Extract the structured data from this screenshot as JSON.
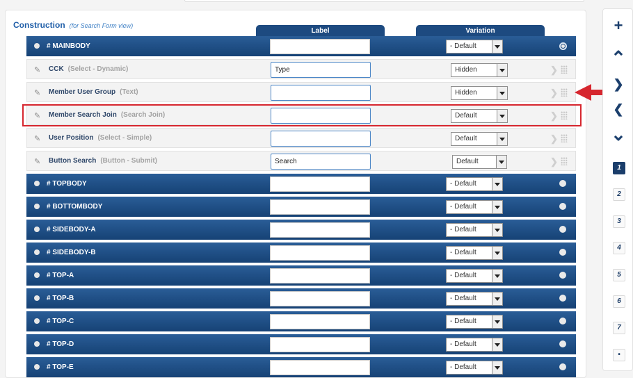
{
  "construction": {
    "title": "Construction",
    "subtitle": "(for Search Form view)"
  },
  "columns": {
    "label": "Label",
    "variation": "Variation"
  },
  "rows": [
    {
      "kind": "position",
      "name": "# MAINBODY",
      "label": "",
      "variation": "- Default",
      "marker": "ring"
    },
    {
      "kind": "field",
      "name": "CCK",
      "type": "(Select - Dynamic)",
      "label": "Type",
      "variation": "Hidden"
    },
    {
      "kind": "field",
      "name": "Member User Group",
      "type": "(Text)",
      "label": "",
      "variation": "Hidden"
    },
    {
      "kind": "field",
      "name": "Member Search Join",
      "type": "(Search Join)",
      "label": "",
      "variation": "Default"
    },
    {
      "kind": "field",
      "name": "User Position",
      "type": "(Select - Simple)",
      "label": "",
      "variation": "Default"
    },
    {
      "kind": "field",
      "name": "Button Search",
      "type": "(Button - Submit)",
      "label": "Search",
      "variation": "Default"
    },
    {
      "kind": "position",
      "name": "# TOPBODY",
      "label": "",
      "variation": "- Default",
      "marker": "radio"
    },
    {
      "kind": "position",
      "name": "# BOTTOMBODY",
      "label": "",
      "variation": "- Default",
      "marker": "radio"
    },
    {
      "kind": "position",
      "name": "# SIDEBODY-A",
      "label": "",
      "variation": "- Default",
      "marker": "radio"
    },
    {
      "kind": "position",
      "name": "# SIDEBODY-B",
      "label": "",
      "variation": "- Default",
      "marker": "radio"
    },
    {
      "kind": "position",
      "name": "# TOP-A",
      "label": "",
      "variation": "- Default",
      "marker": "radio"
    },
    {
      "kind": "position",
      "name": "# TOP-B",
      "label": "",
      "variation": "- Default",
      "marker": "radio"
    },
    {
      "kind": "position",
      "name": "# TOP-C",
      "label": "",
      "variation": "- Default",
      "marker": "radio"
    },
    {
      "kind": "position",
      "name": "# TOP-D",
      "label": "",
      "variation": "- Default",
      "marker": "radio"
    },
    {
      "kind": "position",
      "name": "# TOP-E",
      "label": "",
      "variation": "- Default",
      "marker": "radio"
    }
  ],
  "sidebar": {
    "icons": [
      "plus-icon",
      "chevron-up-icon",
      "chevron-right-icon",
      "chevron-left-icon",
      "chevron-down-icon"
    ],
    "numbers": [
      "1",
      "2",
      "3",
      "4",
      "5",
      "6",
      "7",
      "•"
    ],
    "active": "1"
  },
  "colors": {
    "position_row": "#1d4a80",
    "highlight": "#d6262e",
    "link": "#1f5ea8"
  }
}
